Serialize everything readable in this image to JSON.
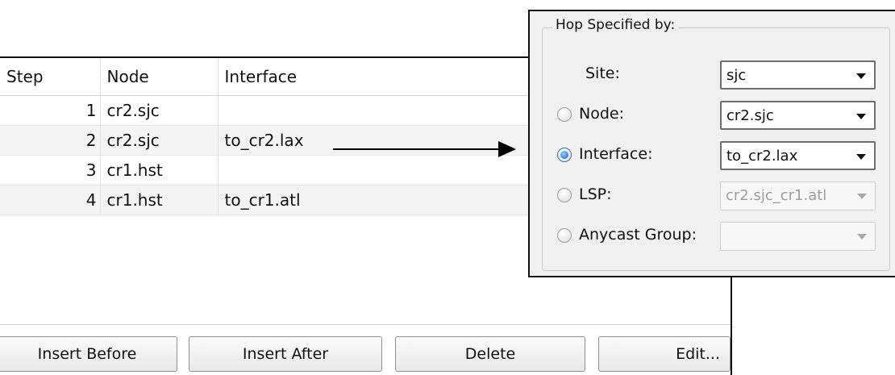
{
  "table": {
    "columns": {
      "step": "Step",
      "node": "Node",
      "interface": "Interface"
    },
    "rows": [
      {
        "step": "1",
        "node": "cr2.sjc",
        "interface": ""
      },
      {
        "step": "2",
        "node": "cr2.sjc",
        "interface": "to_cr2.lax"
      },
      {
        "step": "3",
        "node": "cr1.hst",
        "interface": ""
      },
      {
        "step": "4",
        "node": "cr1.hst",
        "interface": "to_cr1.atl"
      }
    ],
    "buttons": {
      "insert_before": "Insert Before",
      "insert_after": "Insert After",
      "delete": "Delete",
      "edit": "Edit..."
    }
  },
  "hop_dialog": {
    "title": "Hop Specified by:",
    "site": {
      "label": "Site:",
      "value": "sjc"
    },
    "node": {
      "label": "Node:",
      "value": "cr2.sjc",
      "selected": false
    },
    "interface": {
      "label": "Interface:",
      "value": "to_cr2.lax",
      "selected": true
    },
    "lsp": {
      "label": "LSP:",
      "value": "cr2.sjc_cr1.atl",
      "selected": false,
      "disabled": true
    },
    "anycast": {
      "label": "Anycast Group:",
      "value": "",
      "selected": false,
      "disabled": true
    }
  },
  "colors": {
    "radio_selected": "#1a5fb4",
    "row_alt": "#f4f4f4",
    "dialog_bg": "#f0f0f0"
  }
}
